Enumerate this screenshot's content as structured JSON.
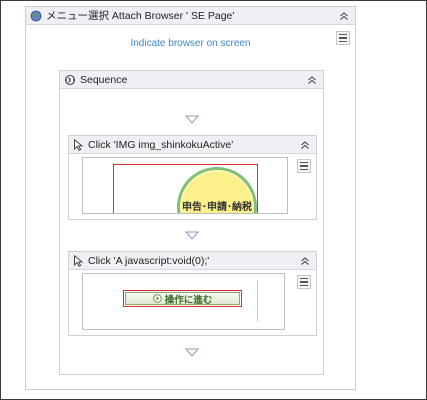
{
  "attach": {
    "title": "メニュー選択   Attach Browser '       SE Page'",
    "indicate_link": "Indicate browser on screen"
  },
  "sequence": {
    "title": "Sequence"
  },
  "activities": [
    {
      "title": "Click 'IMG  img_shinkokuActive'",
      "preview_text": "申告･申請･納税"
    },
    {
      "title": "Click 'A  javascript:void(0);'",
      "preview_text": "操作に進む"
    }
  ],
  "colors": {
    "accent_link": "#3f88c9",
    "header_bg": "#eef0f4",
    "selection_red": "#d62f2f",
    "badge_yellow": "#fbf08a",
    "badge_green": "#7fbf7a"
  }
}
